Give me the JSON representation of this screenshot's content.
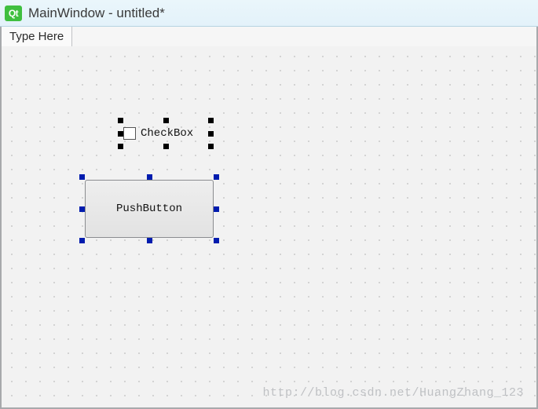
{
  "window": {
    "title": "MainWindow - untitled*",
    "app_badge": "Qt"
  },
  "menubar": {
    "placeholder": "Type Here"
  },
  "widgets": {
    "checkbox": {
      "label": "CheckBox"
    },
    "pushbutton": {
      "label": "PushButton"
    }
  },
  "watermark": "http://blog.csdn.net/HuangZhang_123"
}
